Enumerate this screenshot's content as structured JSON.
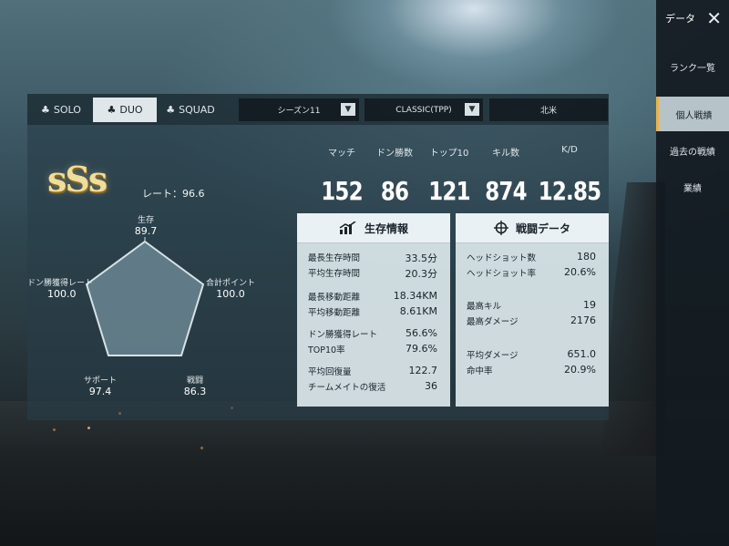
{
  "modes": [
    {
      "label": "SOLO",
      "active": false
    },
    {
      "label": "DUO",
      "active": true
    },
    {
      "label": "SQUAD",
      "active": false
    }
  ],
  "filters": {
    "season": "シーズン11",
    "mode": "CLASSIC(TPP)",
    "region": "北米"
  },
  "sidebar": {
    "title": "データ",
    "items": [
      {
        "label": "ランク一覧"
      },
      {
        "label": "個人戦績"
      },
      {
        "label": "過去の戦績"
      },
      {
        "label": "業績"
      }
    ]
  },
  "tier": {
    "badge": "SSS",
    "rate_label": "レート：96.6"
  },
  "summary": [
    {
      "label": "マッチ",
      "value": "152"
    },
    {
      "label": "ドン勝数",
      "value": "86"
    },
    {
      "label": "トップ10",
      "value": "121"
    },
    {
      "label": "キル数",
      "value": "874"
    },
    {
      "label": "K/D",
      "value": "12.85"
    }
  ],
  "radar": {
    "axes": [
      {
        "label": "生存",
        "value": "89.7"
      },
      {
        "label": "合計ポイント",
        "value": "100.0"
      },
      {
        "label": "戦闘",
        "value": "86.3"
      },
      {
        "label": "サポート",
        "value": "97.4"
      },
      {
        "label": "ドン勝獲得レート",
        "value": "100.0"
      }
    ]
  },
  "survival": {
    "title": "生存情報",
    "rows": [
      {
        "label": "最長生存時間",
        "value": "33.5分"
      },
      {
        "label": "平均生存時間",
        "value": "20.3分"
      },
      {
        "label": "最長移動距離",
        "value": "18.34KM"
      },
      {
        "label": "平均移動距離",
        "value": "8.61KM"
      },
      {
        "label": "ドン勝獲得レート",
        "value": "56.6%"
      },
      {
        "label": "TOP10率",
        "value": "79.6%"
      },
      {
        "label": "平均回復量",
        "value": "122.7"
      },
      {
        "label": "チームメイトの復活",
        "value": "36"
      }
    ]
  },
  "combat": {
    "title": "戦闘データ",
    "rows": [
      {
        "label": "ヘッドショット数",
        "value": "180"
      },
      {
        "label": "ヘッドショット率",
        "value": "20.6%"
      },
      {
        "label": "最高キル",
        "value": "19"
      },
      {
        "label": "最高ダメージ",
        "value": "2176"
      },
      {
        "label": "平均ダメージ",
        "value": "651.0"
      },
      {
        "label": "命中率",
        "value": "20.9%"
      }
    ]
  }
}
